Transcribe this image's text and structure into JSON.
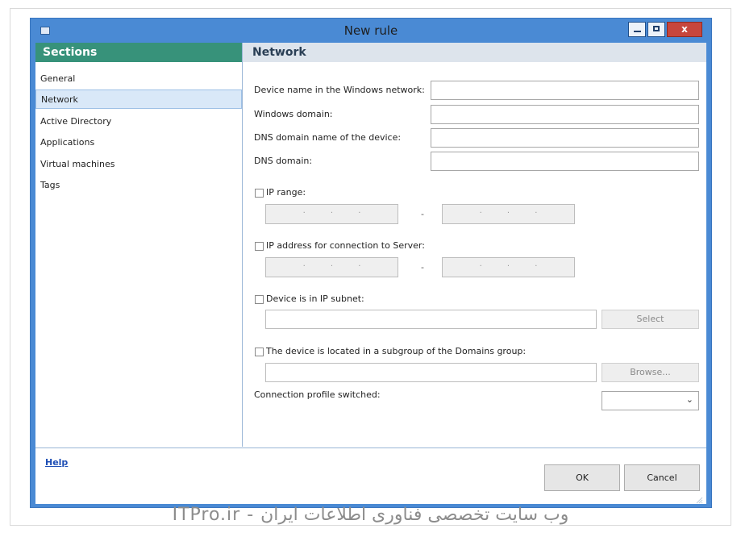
{
  "window": {
    "title": "New rule",
    "close_glyph": "x",
    "accent": "#4a8ad4"
  },
  "sidebar": {
    "header": "Sections",
    "header_color": "#37927a",
    "items": [
      {
        "label": "General",
        "selected": false
      },
      {
        "label": "Network",
        "selected": true
      },
      {
        "label": "Active Directory",
        "selected": false
      },
      {
        "label": "Applications",
        "selected": false
      },
      {
        "label": "Virtual machines",
        "selected": false
      },
      {
        "label": "Tags",
        "selected": false
      }
    ]
  },
  "main": {
    "header": "Network",
    "fields": {
      "device_name_label": "Device name in the Windows network:",
      "device_name_value": "",
      "windows_domain_label": "Windows domain:",
      "windows_domain_value": "",
      "dns_domain_name_label": "DNS domain name of the device:",
      "dns_domain_name_value": "",
      "dns_domain_label": "DNS domain:",
      "dns_domain_value": ""
    },
    "ip_range": {
      "label": "IP range:",
      "checked": false,
      "separator": "-"
    },
    "ip_server": {
      "label": "IP address for connection to Server:",
      "checked": false,
      "separator": "-"
    },
    "ip_subnet": {
      "label": "Device is in IP subnet:",
      "checked": false,
      "button": "Select"
    },
    "subgroup": {
      "label": "The device is located in a subgroup of the Domains group:",
      "checked": false,
      "button": "Browse..."
    },
    "connection_profile": {
      "label": "Connection profile switched:",
      "selected": ""
    }
  },
  "footer": {
    "help": "Help",
    "ok": "OK",
    "cancel": "Cancel"
  },
  "watermark": "ITPro.ir - وب سایت تخصصی فناوری اطلاعات ایران"
}
